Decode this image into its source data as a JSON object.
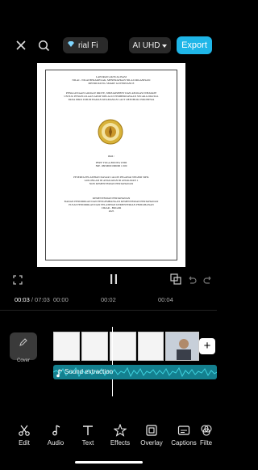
{
  "topbar": {
    "chip_text": "rial  Fi",
    "quality_label": "AI UHD",
    "export_label": "Export"
  },
  "document": {
    "title_lines": [
      "LAPORAN AKTUALISASI",
      "NILAI - NILAI BERAKHLAK, MENERAPKAN NILAI ORGANISASI",
      "MENDUKUNG SMART GOVERNANCE"
    ],
    "subtitle_lines": [
      "PENGGUNAAN GOOGLE DRIVE, SPREADSHEET DAN APLIKASI WHATAPP",
      "UNTUK PENGELOLAAN ARSIP MELALUI PEMBERDAYAAN SECARA DIGITAL",
      "PADA DIRO UMUM BADAN KEAMANAN LAUT REPUBLIK INDONESIA"
    ],
    "by_label": "Oleh :",
    "author_lines": [
      "PERY YOGA BUDYA WIDI",
      "NIP. 19950000 000000 1 000"
    ],
    "program_lines": [
      "PESERTA PELATIHAN DASAR CALON PEGAWAI NEGERI SIPIL",
      "GOLONGAN III ANGKATAN III ANGKATAN 1",
      "NON KEMENTERIAN PERTAHANAN"
    ],
    "footer_lines": [
      "KEMENTERIAN PERTAHANAN",
      "BADAN PENDIDIKAN DAN PENGEMBANGAN KEMENTERIAN PERTAHANAN",
      "PUSAT PENDIDIKAN DAN PELATIHAN KEMENTERIAN PERTAHANAN",
      "CIKAR - BOGOR",
      "2025"
    ]
  },
  "playback": {
    "current_time": "00:03",
    "total_time": "07:03",
    "ticks": [
      "00:00",
      "00:02",
      "00:04"
    ]
  },
  "timeline": {
    "cover_label": "Cover",
    "audio_label": "Sound extraction",
    "add_symbol": "+"
  },
  "toolbar": {
    "items": [
      "Edit",
      "Audio",
      "Text",
      "Effects",
      "Overlay",
      "Captions",
      "Filte"
    ]
  }
}
